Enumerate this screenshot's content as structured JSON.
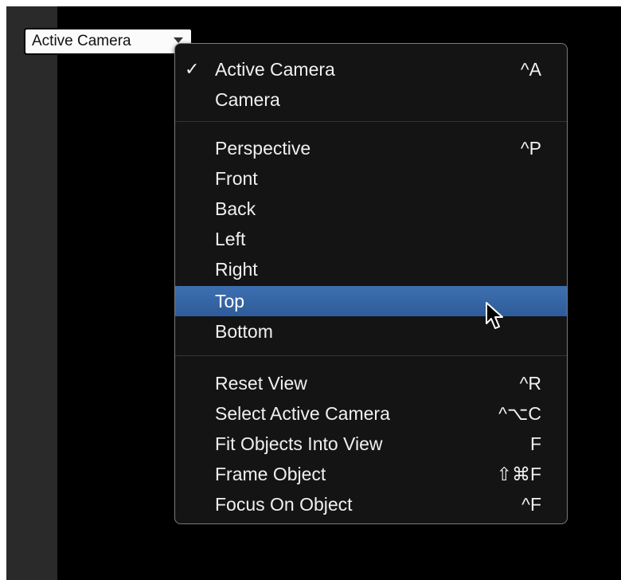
{
  "view_popup": {
    "label": "Active Camera"
  },
  "menu": {
    "groups": [
      [
        {
          "label": "Active Camera",
          "shortcut": "^A",
          "checked": true
        },
        {
          "label": "Camera",
          "shortcut": "",
          "checked": false
        }
      ],
      [
        {
          "label": "Perspective",
          "shortcut": "^P"
        },
        {
          "label": "Front",
          "shortcut": ""
        },
        {
          "label": "Back",
          "shortcut": ""
        },
        {
          "label": "Left",
          "shortcut": ""
        },
        {
          "label": "Right",
          "shortcut": ""
        },
        {
          "label": "Top",
          "shortcut": "",
          "highlighted": true
        },
        {
          "label": "Bottom",
          "shortcut": ""
        }
      ],
      [
        {
          "label": "Reset View",
          "shortcut": "^R"
        },
        {
          "label": "Select Active Camera",
          "shortcut": "^⌥C"
        },
        {
          "label": "Fit Objects Into View",
          "shortcut": "F"
        },
        {
          "label": "Frame Object",
          "shortcut": "⇧⌘F"
        },
        {
          "label": "Focus On Object",
          "shortcut": "^F"
        }
      ]
    ],
    "check_glyph": "✓"
  },
  "colors": {
    "highlight": "#3566a6",
    "menu_bg": "#141414",
    "menu_text": "#f0f0f0"
  }
}
